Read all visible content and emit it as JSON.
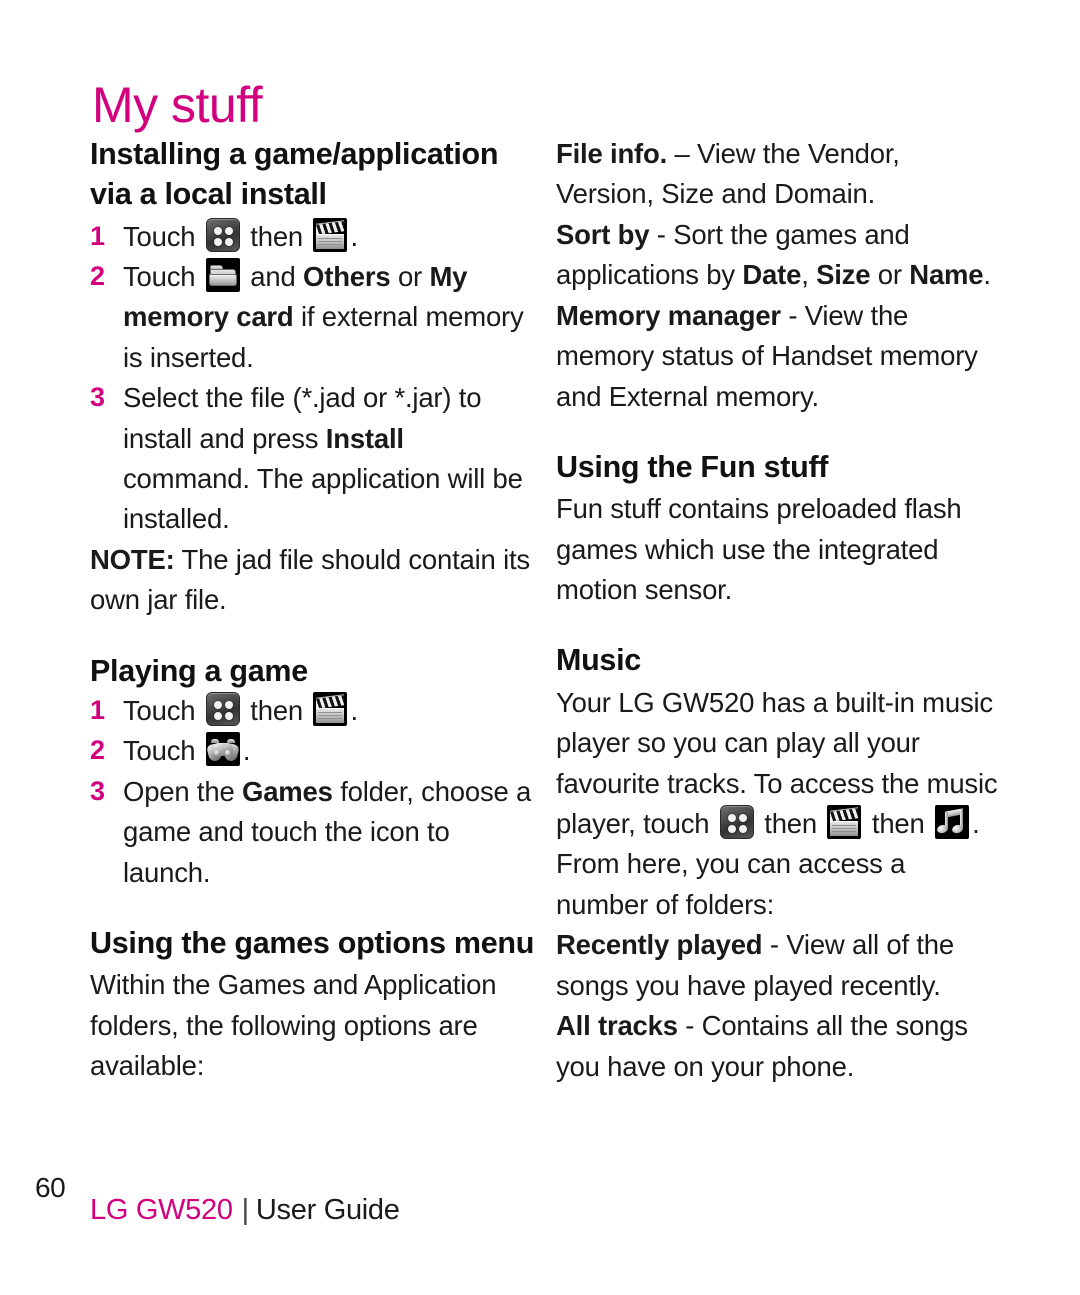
{
  "page": {
    "title": "My stuff",
    "number": "60",
    "accent_color": "#d2007f",
    "text_color": "#1a1a1a"
  },
  "footer": {
    "brand": "LG GW520",
    "divider": "|",
    "guide": "User Guide"
  },
  "left_column": {
    "heading_install": "Installing a game/application via a local install",
    "install_steps": [
      {
        "num": "1",
        "pre": "Touch",
        "icons": [
          "grid-icon",
          "clapperboard-icon"
        ],
        "mid": "then",
        "post": "."
      },
      {
        "num": "2",
        "pre": "Touch",
        "icons": [
          "folder-icon"
        ],
        "after_icon_1": "and",
        "bold_1": "Others",
        "mid_1": "or",
        "bold_2": "My memory card",
        "tail": "if external memory is inserted."
      },
      {
        "num": "3",
        "text_1": "Select the file (*.jad or *.jar) to install and press",
        "bold_1": "Install",
        "text_2": "command. The application will be installed."
      }
    ],
    "note_label": "NOTE:",
    "note_text": "The jad file should contain its own jar file.",
    "heading_playing": "Playing a game",
    "playing_steps": [
      {
        "num": "1",
        "pre": "Touch",
        "mid": "then",
        "post": "."
      },
      {
        "num": "2",
        "pre": "Touch",
        "post": "."
      },
      {
        "num": "3",
        "text_1": "Open the",
        "bold_1": "Games",
        "text_2": "folder, choose a game and touch the icon to launch."
      }
    ],
    "heading_options": "Using the games options menu",
    "options_intro": "Within the Games and Application folders, the following options are available:"
  },
  "right_column": {
    "file_info_label": "File info.",
    "file_info_text": "– View the Vendor, Version, Size and Domain.",
    "sort_by_label": "Sort by",
    "sort_by_text_1": "- Sort the games and applications by",
    "sort_by_bold_1": "Date",
    "sort_by_sep_1": ",",
    "sort_by_bold_2": "Size",
    "sort_by_mid": "or",
    "sort_by_bold_3": "Name",
    "sort_by_end": ".",
    "memory_manager_label": "Memory manager",
    "memory_manager_text": "- View the memory status of Handset memory and External memory.",
    "heading_fun_stuff": "Using the Fun stuff",
    "fun_stuff_text": "Fun stuff contains preloaded flash games which use the integrated motion sensor.",
    "heading_music": "Music",
    "music_text_1": "Your LG GW520 has a built-in music player so you can play all your favourite tracks. To access the music player, touch",
    "music_then_1": "then",
    "music_then_2": "then",
    "music_text_2": ". From here, you can access a number of folders:",
    "recently_played_label": "Recently played",
    "recently_played_text": "- View all of the songs you have played recently.",
    "all_tracks_label": "All tracks",
    "all_tracks_text": "- Contains all the songs you have on your phone."
  },
  "icons": {
    "grid": "grid-icon",
    "clapperboard": "clapperboard-icon",
    "folder": "folder-icon",
    "gamepad": "gamepad-icon",
    "music_note": "music-note-icon"
  }
}
